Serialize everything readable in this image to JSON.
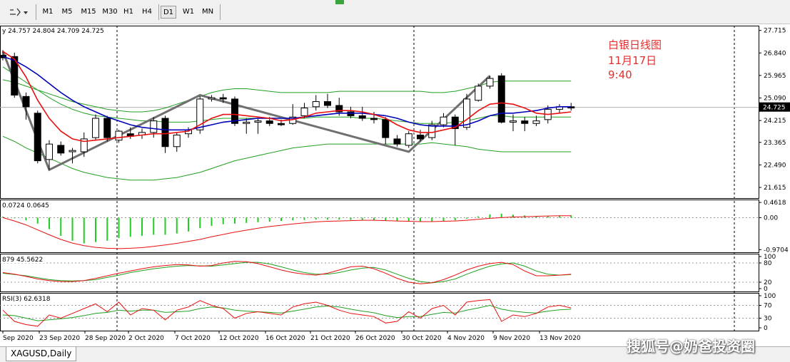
{
  "toolbar": {
    "timeframes": [
      "M1",
      "M5",
      "M15",
      "M30",
      "H1",
      "H4",
      "D1",
      "W1",
      "MN"
    ],
    "active": "D1"
  },
  "symbol_tab": "XAGUSD,Daily",
  "watermark": "搜狐号@奶爸投资圈",
  "annotation": {
    "line1": "白银日线图",
    "line2": "11月17日",
    "line3": "9:40"
  },
  "colors": {
    "bull": "#ffffff",
    "bear": "#000000",
    "ma_fast": "#e81010",
    "ma_slow": "#0000b8",
    "bollinger": "#22a022",
    "zigzag": "#707070",
    "macd_hist": "#22cc22",
    "signal": "#e81010"
  },
  "chart_data": [
    {
      "type": "candlestick",
      "symbol": "XAGUSD",
      "timeframe": "Daily",
      "header": "y 24.757 24.804 24.709 24.725",
      "current_price": "24.725",
      "ylim": [
        21.2,
        27.9
      ],
      "price_ticks": [
        "27.715",
        "26.840",
        "25.965",
        "25.090",
        "24.215",
        "23.365",
        "22.490",
        "21.615"
      ],
      "x_labels": [
        "Sep 2020",
        "23 Sep 2020",
        "28 Sep 2020",
        "2 Oct 2020",
        "7 Oct 2020",
        "12 Oct 2020",
        "16 Oct 2020",
        "21 Oct 2020",
        "26 Oct 2020",
        "30 Oct 2020",
        "4 Nov 2020",
        "9 Nov 2020",
        "13 Nov 2020"
      ],
      "candles": [
        {
          "o": 26.75,
          "h": 26.95,
          "l": 26.55,
          "c": 26.65
        },
        {
          "o": 26.7,
          "h": 26.85,
          "l": 25.1,
          "c": 25.2
        },
        {
          "o": 25.15,
          "h": 25.3,
          "l": 24.25,
          "c": 24.75
        },
        {
          "o": 24.5,
          "h": 24.6,
          "l": 22.55,
          "c": 22.65
        },
        {
          "o": 22.7,
          "h": 23.45,
          "l": 22.3,
          "c": 23.3
        },
        {
          "o": 23.25,
          "h": 23.4,
          "l": 22.85,
          "c": 22.95
        },
        {
          "o": 23.0,
          "h": 23.15,
          "l": 22.55,
          "c": 23.05
        },
        {
          "o": 23.0,
          "h": 23.75,
          "l": 22.8,
          "c": 23.5
        },
        {
          "o": 23.55,
          "h": 24.45,
          "l": 23.45,
          "c": 24.3
        },
        {
          "o": 24.3,
          "h": 24.4,
          "l": 23.4,
          "c": 23.55
        },
        {
          "o": 23.45,
          "h": 23.85,
          "l": 23.35,
          "c": 23.8
        },
        {
          "o": 23.7,
          "h": 23.95,
          "l": 23.5,
          "c": 23.6
        },
        {
          "o": 23.65,
          "h": 23.9,
          "l": 23.5,
          "c": 23.75
        },
        {
          "o": 23.75,
          "h": 24.35,
          "l": 23.55,
          "c": 24.2
        },
        {
          "o": 24.3,
          "h": 24.4,
          "l": 22.95,
          "c": 23.2
        },
        {
          "o": 23.2,
          "h": 23.75,
          "l": 23.0,
          "c": 23.65
        },
        {
          "o": 23.7,
          "h": 23.95,
          "l": 23.55,
          "c": 23.85
        },
        {
          "o": 23.85,
          "h": 25.15,
          "l": 23.7,
          "c": 25.05
        },
        {
          "o": 25.05,
          "h": 25.2,
          "l": 24.95,
          "c": 25.1
        },
        {
          "o": 25.1,
          "h": 25.25,
          "l": 24.9,
          "c": 25.05
        },
        {
          "o": 25.05,
          "h": 25.15,
          "l": 24.0,
          "c": 24.1
        },
        {
          "o": 24.1,
          "h": 24.3,
          "l": 23.7,
          "c": 24.15
        },
        {
          "o": 24.15,
          "h": 24.3,
          "l": 23.7,
          "c": 24.2
        },
        {
          "o": 24.2,
          "h": 24.35,
          "l": 24.0,
          "c": 24.1
        },
        {
          "o": 24.1,
          "h": 24.25,
          "l": 24.0,
          "c": 24.05
        },
        {
          "o": 24.1,
          "h": 24.85,
          "l": 24.05,
          "c": 24.35
        },
        {
          "o": 24.4,
          "h": 24.9,
          "l": 24.3,
          "c": 24.7
        },
        {
          "o": 24.75,
          "h": 25.2,
          "l": 24.6,
          "c": 24.95
        },
        {
          "o": 24.95,
          "h": 25.25,
          "l": 24.7,
          "c": 24.8
        },
        {
          "o": 24.8,
          "h": 25.1,
          "l": 24.4,
          "c": 24.55
        },
        {
          "o": 24.55,
          "h": 24.75,
          "l": 24.3,
          "c": 24.4
        },
        {
          "o": 24.4,
          "h": 24.75,
          "l": 24.2,
          "c": 24.3
        },
        {
          "o": 24.3,
          "h": 24.55,
          "l": 24.1,
          "c": 24.25
        },
        {
          "o": 24.25,
          "h": 24.35,
          "l": 23.3,
          "c": 23.55
        },
        {
          "o": 23.5,
          "h": 23.65,
          "l": 23.2,
          "c": 23.3
        },
        {
          "o": 23.25,
          "h": 23.8,
          "l": 23.15,
          "c": 23.7
        },
        {
          "o": 23.65,
          "h": 23.85,
          "l": 23.4,
          "c": 23.5
        },
        {
          "o": 23.55,
          "h": 24.2,
          "l": 23.45,
          "c": 24.05
        },
        {
          "o": 24.05,
          "h": 24.5,
          "l": 23.95,
          "c": 24.35
        },
        {
          "o": 24.35,
          "h": 24.45,
          "l": 23.25,
          "c": 23.9
        },
        {
          "o": 23.95,
          "h": 25.25,
          "l": 23.85,
          "c": 25.05
        },
        {
          "o": 25.0,
          "h": 25.65,
          "l": 24.95,
          "c": 25.55
        },
        {
          "o": 25.55,
          "h": 25.95,
          "l": 25.45,
          "c": 25.85
        },
        {
          "o": 25.95,
          "h": 26.05,
          "l": 24.1,
          "c": 24.15
        },
        {
          "o": 24.15,
          "h": 24.45,
          "l": 23.8,
          "c": 24.2
        },
        {
          "o": 24.2,
          "h": 24.35,
          "l": 23.8,
          "c": 24.1
        },
        {
          "o": 24.1,
          "h": 24.4,
          "l": 24.0,
          "c": 24.2
        },
        {
          "o": 24.25,
          "h": 24.8,
          "l": 24.1,
          "c": 24.65
        },
        {
          "o": 24.65,
          "h": 24.85,
          "l": 24.5,
          "c": 24.75
        },
        {
          "o": 24.75,
          "h": 24.9,
          "l": 24.6,
          "c": 24.7
        }
      ],
      "bollinger_upper": [
        25.8,
        25.7,
        25.55,
        25.4,
        25.25,
        25.1,
        24.95,
        24.85,
        24.75,
        24.65,
        24.6,
        24.55,
        24.55,
        24.6,
        24.7,
        24.85,
        25.0,
        25.15,
        25.3,
        25.4,
        25.45,
        25.45,
        25.4,
        25.35,
        25.3,
        25.3,
        25.3,
        25.3,
        25.3,
        25.35,
        25.35,
        25.35,
        25.35,
        25.35,
        25.35,
        25.35,
        25.35,
        25.3,
        25.3,
        25.35,
        25.45,
        25.55,
        25.7,
        25.75,
        25.75,
        25.75,
        25.75,
        25.75,
        25.75,
        25.75
      ],
      "bollinger_mid": [
        26.3,
        26.0,
        25.7,
        25.4,
        25.1,
        24.85,
        24.65,
        24.5,
        24.4,
        24.35,
        24.3,
        24.25,
        24.2,
        24.2,
        24.15,
        24.15,
        24.15,
        24.2,
        24.25,
        24.3,
        24.3,
        24.3,
        24.3,
        24.3,
        24.3,
        24.3,
        24.3,
        24.35,
        24.35,
        24.35,
        24.35,
        24.3,
        24.3,
        24.25,
        24.2,
        24.15,
        24.1,
        24.1,
        24.1,
        24.15,
        24.2,
        24.3,
        24.4,
        24.4,
        24.35,
        24.35,
        24.35,
        24.35,
        24.35,
        24.35
      ],
      "bollinger_lower": [
        23.6,
        23.4,
        23.15,
        22.95,
        22.75,
        22.55,
        22.35,
        22.2,
        22.1,
        22.0,
        21.95,
        21.9,
        21.9,
        21.9,
        21.95,
        22.0,
        22.1,
        22.2,
        22.35,
        22.5,
        22.65,
        22.75,
        22.85,
        22.95,
        23.05,
        23.15,
        23.2,
        23.25,
        23.3,
        23.3,
        23.3,
        23.3,
        23.3,
        23.3,
        23.3,
        23.3,
        23.3,
        23.35,
        23.3,
        23.25,
        23.2,
        23.1,
        23.05,
        23.0,
        23.0,
        23.0,
        23.0,
        23.0,
        23.0,
        23.0
      ],
      "ma_fast": [
        26.9,
        26.6,
        25.9,
        25.0,
        24.3,
        23.8,
        23.5,
        23.4,
        23.45,
        23.5,
        23.55,
        23.6,
        23.65,
        23.7,
        23.7,
        23.75,
        23.8,
        24.05,
        24.3,
        24.45,
        24.45,
        24.4,
        24.35,
        24.3,
        24.2,
        24.25,
        24.35,
        24.5,
        24.55,
        24.6,
        24.6,
        24.55,
        24.45,
        24.3,
        24.05,
        23.85,
        23.75,
        23.75,
        23.85,
        23.95,
        24.25,
        24.6,
        24.85,
        24.9,
        24.85,
        24.7,
        24.5,
        24.45,
        24.5,
        24.55
      ],
      "ma_slow": [
        26.7,
        26.55,
        26.3,
        26.0,
        25.65,
        25.3,
        25.0,
        24.75,
        24.55,
        24.35,
        24.2,
        24.05,
        23.95,
        23.9,
        23.85,
        23.85,
        23.85,
        23.95,
        24.05,
        24.15,
        24.2,
        24.25,
        24.3,
        24.3,
        24.3,
        24.3,
        24.35,
        24.4,
        24.45,
        24.5,
        24.5,
        24.5,
        24.45,
        24.4,
        24.3,
        24.15,
        24.05,
        24.0,
        24.0,
        24.0,
        24.05,
        24.2,
        24.4,
        24.5,
        24.5,
        24.55,
        24.6,
        24.7,
        24.75,
        24.75
      ],
      "zigzag": [
        {
          "i": 0,
          "p": 26.9
        },
        {
          "i": 4,
          "p": 22.3
        },
        {
          "i": 17,
          "p": 25.2
        },
        {
          "i": 35,
          "p": 23.0
        },
        {
          "i": 42,
          "p": 25.95
        }
      ],
      "vlines_index": [
        10,
        36
      ]
    },
    {
      "type": "macd",
      "header": "0.0724 0.0645",
      "ticks": [
        "0.4618",
        "0.00",
        "-0.9704"
      ],
      "ylim": [
        -1.05,
        0.55
      ],
      "histogram": [
        0.03,
        -0.02,
        -0.08,
        -0.18,
        -0.35,
        -0.55,
        -0.7,
        -0.78,
        -0.74,
        -0.7,
        -0.62,
        -0.58,
        -0.55,
        -0.52,
        -0.52,
        -0.48,
        -0.42,
        -0.32,
        -0.25,
        -0.2,
        -0.18,
        -0.16,
        -0.14,
        -0.12,
        -0.1,
        -0.08,
        -0.07,
        -0.06,
        -0.06,
        -0.06,
        -0.07,
        -0.07,
        -0.08,
        -0.09,
        -0.1,
        -0.11,
        -0.12,
        -0.12,
        -0.1,
        -0.08,
        -0.03,
        0.04,
        0.1,
        0.12,
        0.09,
        0.07,
        0.05,
        0.05,
        0.06,
        0.07
      ],
      "signal": [
        0.0,
        -0.1,
        -0.22,
        -0.37,
        -0.52,
        -0.66,
        -0.77,
        -0.85,
        -0.9,
        -0.93,
        -0.94,
        -0.93,
        -0.91,
        -0.87,
        -0.83,
        -0.78,
        -0.72,
        -0.66,
        -0.58,
        -0.51,
        -0.44,
        -0.38,
        -0.32,
        -0.27,
        -0.23,
        -0.19,
        -0.16,
        -0.13,
        -0.11,
        -0.1,
        -0.09,
        -0.08,
        -0.08,
        -0.09,
        -0.1,
        -0.11,
        -0.12,
        -0.12,
        -0.11,
        -0.1,
        -0.08,
        -0.05,
        -0.02,
        0.0,
        0.02,
        0.03,
        0.04,
        0.05,
        0.06,
        0.06
      ]
    },
    {
      "type": "stochastic",
      "header": "879 45.5622",
      "ticks": [
        "100",
        "80",
        "20",
        "0"
      ],
      "ylim": [
        0,
        100
      ],
      "k": [
        50,
        45,
        38,
        30,
        25,
        22,
        22,
        25,
        32,
        40,
        48,
        55,
        62,
        68,
        72,
        75,
        74,
        70,
        72,
        80,
        85,
        84,
        78,
        68,
        58,
        50,
        45,
        42,
        48,
        58,
        68,
        70,
        62,
        48,
        32,
        20,
        15,
        18,
        28,
        42,
        58,
        70,
        78,
        82,
        75,
        55,
        40,
        40,
        42,
        45
      ],
      "d": [
        48,
        44,
        40,
        34,
        28,
        25,
        24,
        25,
        28,
        35,
        42,
        50,
        56,
        62,
        66,
        70,
        72,
        71,
        70,
        74,
        78,
        82,
        82,
        77,
        68,
        58,
        50,
        45,
        45,
        50,
        58,
        64,
        66,
        58,
        45,
        32,
        22,
        18,
        22,
        30,
        45,
        58,
        70,
        77,
        80,
        70,
        55,
        45,
        42,
        44
      ]
    },
    {
      "type": "rsi",
      "header": "RSI(3) 62.6318",
      "ticks": [
        "100",
        "70",
        "30",
        "0"
      ],
      "ylim": [
        0,
        100
      ],
      "rsi": [
        55,
        20,
        10,
        5,
        40,
        30,
        45,
        60,
        75,
        50,
        80,
        40,
        60,
        55,
        25,
        55,
        65,
        85,
        70,
        60,
        30,
        45,
        50,
        45,
        40,
        65,
        75,
        80,
        70,
        55,
        45,
        40,
        35,
        15,
        20,
        50,
        30,
        60,
        70,
        40,
        80,
        85,
        88,
        20,
        40,
        35,
        45,
        65,
        70,
        62
      ],
      "ma": [
        40,
        38,
        30,
        22,
        25,
        28,
        32,
        38,
        45,
        48,
        55,
        52,
        55,
        55,
        48,
        50,
        52,
        60,
        65,
        62,
        55,
        52,
        50,
        48,
        46,
        52,
        58,
        65,
        68,
        65,
        58,
        52,
        47,
        38,
        32,
        35,
        35,
        42,
        48,
        46,
        55,
        62,
        70,
        58,
        52,
        48,
        46,
        52,
        56,
        58
      ]
    }
  ]
}
